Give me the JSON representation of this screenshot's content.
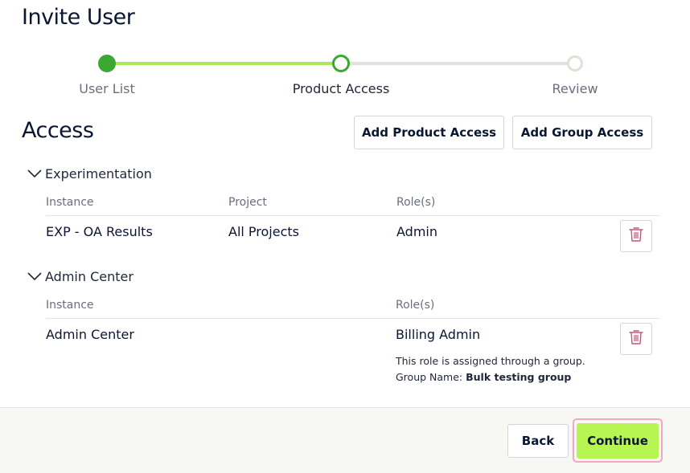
{
  "page": {
    "title": "Invite User"
  },
  "stepper": {
    "steps": [
      {
        "label": "User List",
        "state": "complete"
      },
      {
        "label": "Product Access",
        "state": "current"
      },
      {
        "label": "Review",
        "state": "upcoming"
      }
    ],
    "colors": {
      "complete": "#3aa832",
      "progress": "#a6ea5c",
      "upcoming": "#dfe2d8"
    }
  },
  "access": {
    "title": "Access",
    "add_product_label": "Add Product Access",
    "add_group_label": "Add Group Access"
  },
  "groups": [
    {
      "name": "Experimentation",
      "columns": [
        "Instance",
        "Project",
        "Role(s)"
      ],
      "rows": [
        {
          "instance": "EXP - OA Results",
          "project": "All Projects",
          "role": "Admin",
          "delete_icon": "trash-icon"
        }
      ]
    },
    {
      "name": "Admin Center",
      "columns": [
        "Instance",
        "Role(s)"
      ],
      "rows": [
        {
          "instance": "Admin Center",
          "role": "Billing Admin",
          "note": "This role is assigned through a group.",
          "group_label": "Group Name:",
          "group_name": "Bulk testing group",
          "delete_icon": "trash-icon"
        }
      ]
    }
  ],
  "footer": {
    "back_label": "Back",
    "continue_label": "Continue",
    "accent": "#b6f552",
    "focus_ring": "#f2a6c3"
  }
}
